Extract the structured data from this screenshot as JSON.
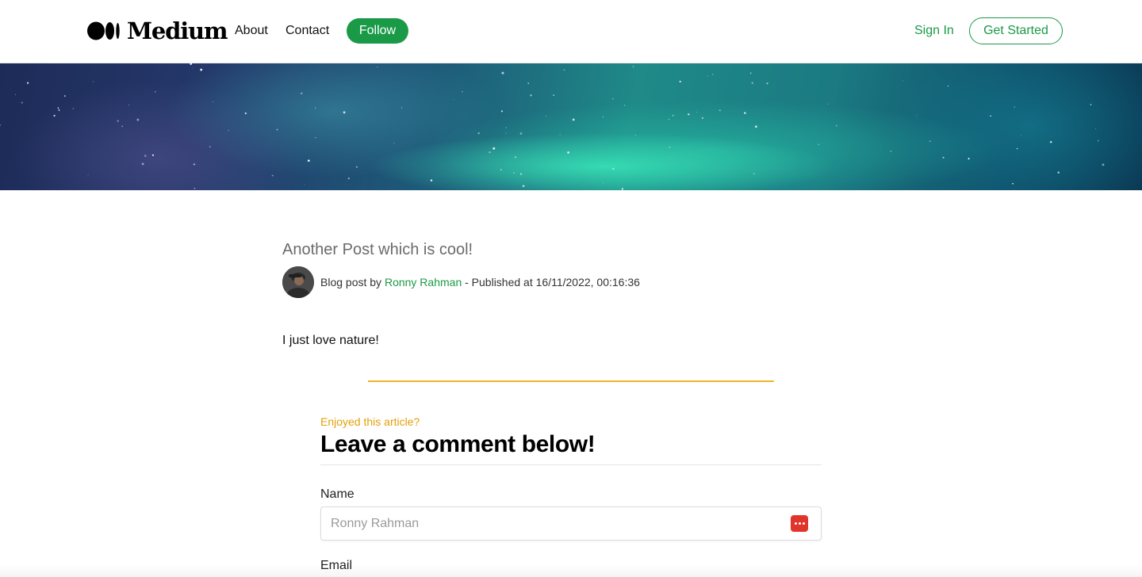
{
  "header": {
    "logo_text": "Medium",
    "nav": [
      {
        "label": "About"
      },
      {
        "label": "Contact"
      }
    ],
    "follow_label": "Follow",
    "sign_in_label": "Sign In",
    "get_started_label": "Get Started"
  },
  "post": {
    "title": "Another Post which is cool!",
    "meta_prefix": "Blog post by",
    "author": "Ronny Rahman",
    "meta_suffix": "- Published at 16/11/2022, 00:16:36",
    "body": "I just love nature!"
  },
  "comments": {
    "kicker": "Enjoyed this article?",
    "heading": "Leave a comment below!",
    "name_label": "Name",
    "name_placeholder": "Ronny Rahman",
    "email_label": "Email"
  },
  "colors": {
    "accent_green": "#1a9a47",
    "accent_gold": "#f0b429",
    "password_manager_icon": "#e1352c"
  },
  "icons": {
    "logo": "medium-logo-icon",
    "avatar": "author-avatar",
    "password_manager": "password-manager-icon"
  }
}
